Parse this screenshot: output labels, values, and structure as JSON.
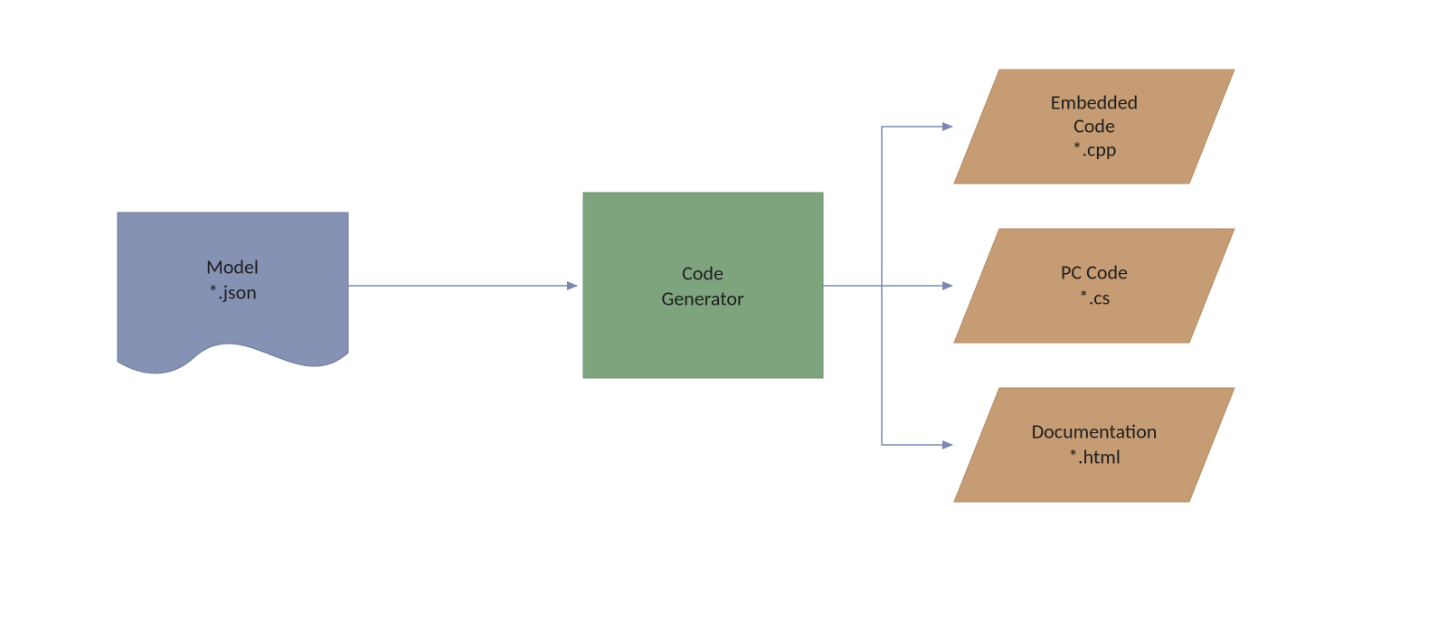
{
  "nodes": {
    "model": {
      "title": "Model",
      "subtitle": "*.json",
      "fill": "#8692b3",
      "stroke": "#6b7899"
    },
    "generator": {
      "title": "Code",
      "subtitle": "Generator",
      "fill": "#7ea47e",
      "stroke": "#6b8f6b"
    },
    "outputs": [
      {
        "title": "Embedded",
        "subtitle1": "Code",
        "subtitle2": "*.cpp"
      },
      {
        "title": "PC Code",
        "subtitle1": "*.cs",
        "subtitle2": ""
      },
      {
        "title": "Documentation",
        "subtitle1": "*.html",
        "subtitle2": ""
      }
    ],
    "output_style": {
      "fill": "#c69c74",
      "stroke": "#b38c66"
    }
  },
  "arrow": {
    "stroke": "#7b89b0",
    "width": 1.5
  }
}
